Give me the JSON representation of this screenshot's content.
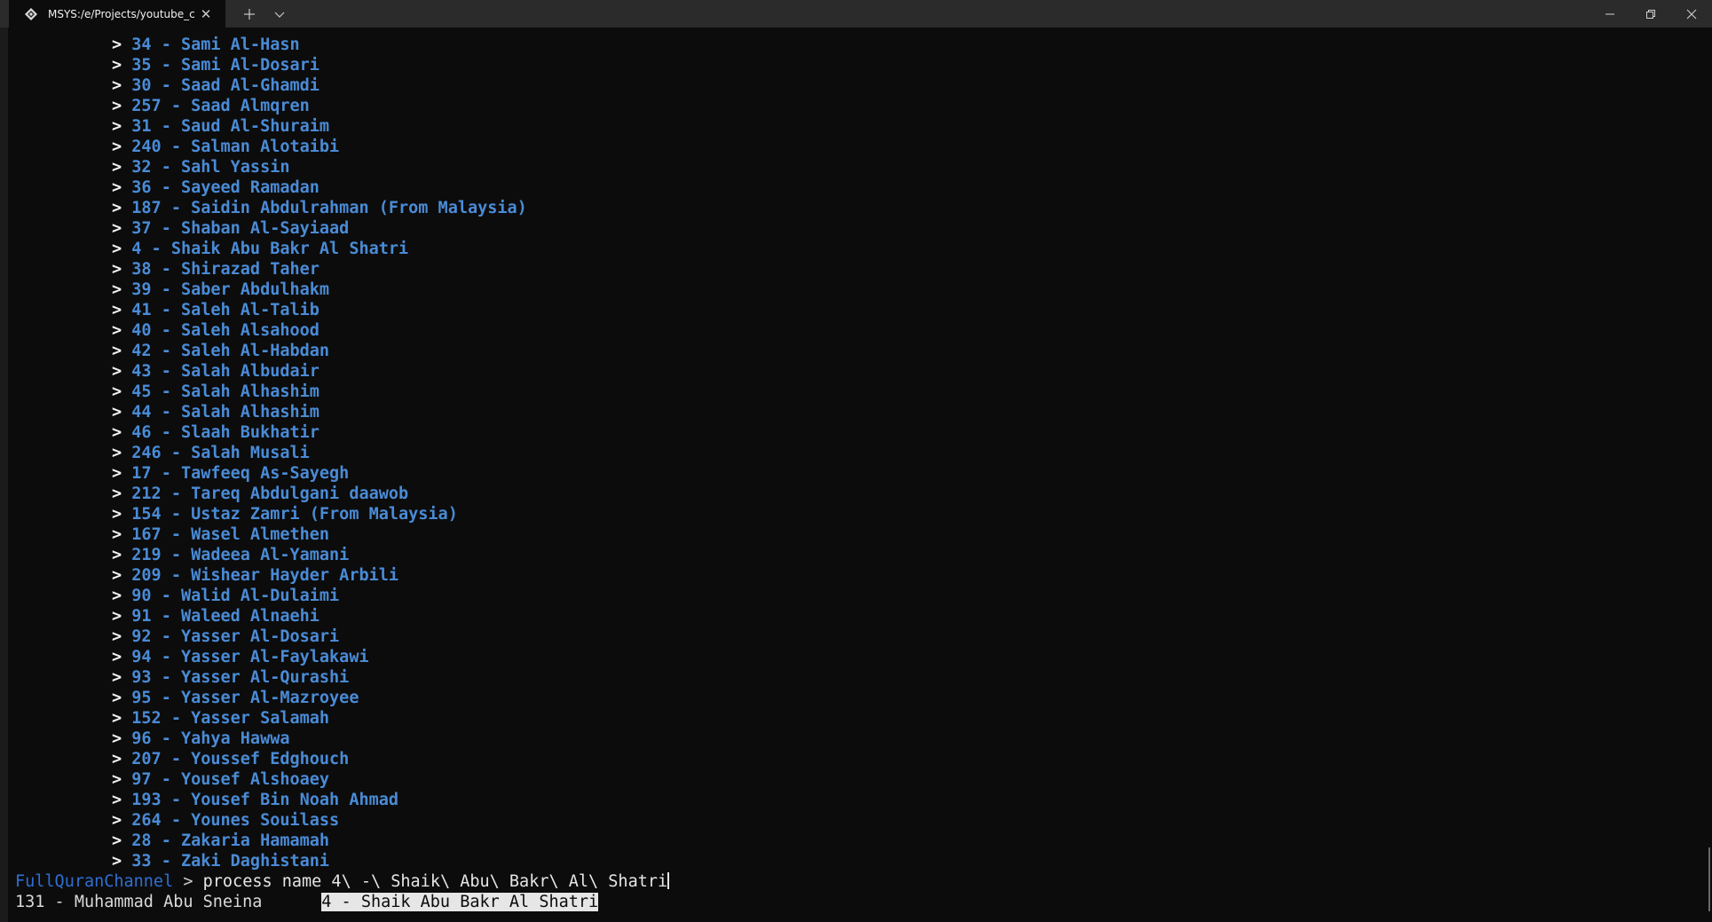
{
  "tab": {
    "title": "MSYS:/e/Projects/youtube_char",
    "icon": "msys-diamond-icon",
    "close": "✕"
  },
  "titlebar": {
    "new_tab": "+",
    "dropdown": "⌄"
  },
  "menu_items": [
    "34 - Sami Al-Hasn",
    "35 - Sami Al-Dosari",
    "30 - Saad Al-Ghamdi",
    "257 - Saad Almqren",
    "31 - Saud Al-Shuraim",
    "240 - Salman Alotaibi",
    "32 - Sahl Yassin",
    "36 - Sayeed Ramadan",
    "187 - Saidin Abdulrahman (From Malaysia)",
    "37 - Shaban Al-Sayiaad",
    "4 - Shaik Abu Bakr Al Shatri",
    "38 - Shirazad Taher",
    "39 - Saber Abdulhakm",
    "41 - Saleh Al-Talib",
    "40 - Saleh Alsahood",
    "42 - Saleh Al-Habdan",
    "43 - Salah Albudair",
    "45 - Salah Alhashim",
    "44 - Salah Alhashim",
    "46 - Slaah Bukhatir",
    "246 - Salah Musali",
    "17 - Tawfeeq As-Sayegh",
    "212 - Tareq Abdulgani daawob",
    "154 - Ustaz Zamri (From Malaysia)",
    "167 - Wasel Almethen",
    "219 - Wadeea Al-Yamani",
    "209 - Wishear Hayder Arbili",
    "90 - Walid Al-Dulaimi",
    "91 - Waleed Alnaehi",
    "92 - Yasser Al-Dosari",
    "94 - Yasser Al-Faylakawi",
    "93 - Yasser Al-Qurashi",
    "95 - Yasser Al-Mazroyee",
    "152 - Yasser Salamah",
    "96 - Yahya Hawwa",
    "207 - Youssef Edghouch",
    "97 - Yousef Alshoaey",
    "193 - Yousef Bin Noah Ahmad",
    "264 - Younes Souilass",
    "28 - Zakaria Hamamah",
    "33 - Zaki Daghistani"
  ],
  "menu_marker": ">",
  "prompt": {
    "name": "FullQuranChannel",
    "separator": " > ",
    "command": "process name 4\\ -\\ Shaik\\ Abu\\ Bakr\\ Al\\ Shatri"
  },
  "suggestions": {
    "first": "131 - Muhammad Abu Sneina",
    "second": "4 - Shaik Abu Bakr Al Shatri"
  },
  "colors": {
    "background": "#0c0c0c",
    "menu_text": "#4a8bd6",
    "prompt_name": "#2f6fd3"
  }
}
